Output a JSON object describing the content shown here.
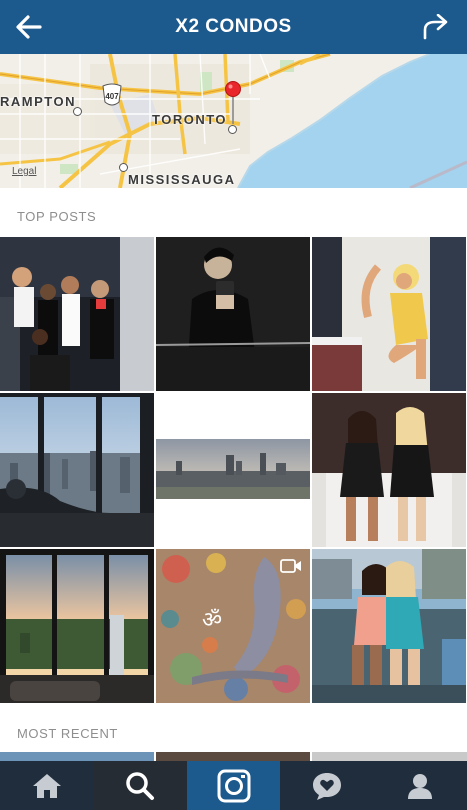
{
  "header": {
    "title": "X2 CONDOS",
    "back_icon": "back-arrow-icon",
    "share_icon": "share-icon"
  },
  "map": {
    "labels": {
      "brampton": "RAMPTON",
      "toronto": "TORONTO",
      "mississauga": "MISSISSAUGA",
      "highway": "407"
    },
    "legal": "Legal",
    "pin_icon": "map-pin-icon"
  },
  "sections": {
    "top_posts": "TOP POSTS",
    "most_recent": "MOST RECENT"
  },
  "posts": [
    {
      "name": "post-group-night-party"
    },
    {
      "name": "post-mirror-selfie"
    },
    {
      "name": "post-yellow-costume"
    },
    {
      "name": "post-window-silhouette"
    },
    {
      "name": "post-skyline-panorama"
    },
    {
      "name": "post-two-women-chair"
    },
    {
      "name": "post-sunset-window"
    },
    {
      "name": "post-om-painting",
      "video_icon": "video-camera-icon",
      "symbol": "ॐ"
    },
    {
      "name": "post-rooftop-friends"
    }
  ],
  "tabs": [
    {
      "name": "home",
      "icon": "home-icon"
    },
    {
      "name": "search",
      "icon": "search-icon"
    },
    {
      "name": "camera",
      "icon": "camera-icon"
    },
    {
      "name": "activity",
      "icon": "heart-bubble-icon"
    },
    {
      "name": "profile",
      "icon": "profile-icon"
    }
  ],
  "colors": {
    "header_bg": "#1c5a8e",
    "tabbar_bg": "#1f2d3d",
    "section_text": "#8e8e8e",
    "water": "#9fd0ea"
  }
}
